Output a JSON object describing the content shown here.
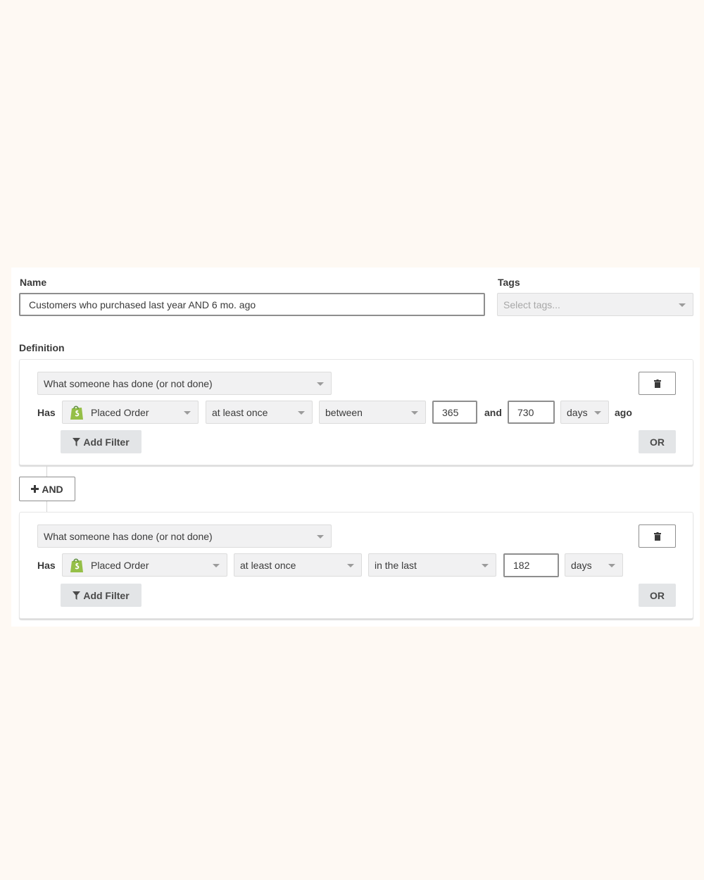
{
  "name_field": {
    "label": "Name",
    "value": "Customers who purchased last year AND 6 mo. ago"
  },
  "tags_field": {
    "label": "Tags",
    "placeholder": "Select tags..."
  },
  "definition": {
    "label": "Definition",
    "and_button_label": "AND",
    "conditions": [
      {
        "type_select": "What someone has done (or not done)",
        "has_label": "Has",
        "metric": "Placed Order",
        "frequency": "at least once",
        "timeframe": "between",
        "value_1": "365",
        "and_label": "and",
        "value_2": "730",
        "unit": "days",
        "suffix": "ago",
        "add_filter_label": "Add Filter",
        "or_label": "OR"
      },
      {
        "type_select": "What someone has done (or not done)",
        "has_label": "Has",
        "metric": "Placed Order",
        "frequency": "at least once",
        "timeframe": "in the last",
        "value_1": "182",
        "unit": "days",
        "add_filter_label": "Add Filter",
        "or_label": "OR"
      }
    ]
  },
  "icons": {
    "metric_icon": "shopify-bag-icon",
    "delete_icon": "trash-icon",
    "filter_icon": "funnel-icon",
    "add_icon": "plus-icon"
  },
  "colors": {
    "background": "#fef9f3",
    "panel": "#ffffff",
    "shopify_green": "#95bf47"
  }
}
